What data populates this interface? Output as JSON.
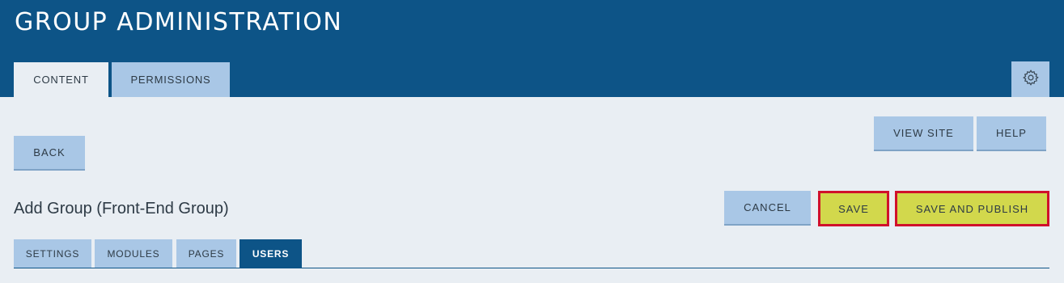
{
  "header": {
    "title": "GROUP ADMINISTRATION",
    "tabs": [
      {
        "label": "CONTENT",
        "active": true
      },
      {
        "label": "PERMISSIONS",
        "active": false
      }
    ],
    "settings_icon": "gear-icon"
  },
  "toolbar": {
    "back_label": "BACK",
    "view_site_label": "VIEW SITE",
    "help_label": "HELP"
  },
  "page": {
    "title": "Add Group (Front-End Group)",
    "cancel_label": "CANCEL",
    "save_label": "SAVE",
    "save_publish_label": "SAVE AND PUBLISH"
  },
  "subtabs": [
    {
      "label": "SETTINGS",
      "active": false
    },
    {
      "label": "MODULES",
      "active": false
    },
    {
      "label": "PAGES",
      "active": false
    },
    {
      "label": "USERS",
      "active": true
    }
  ],
  "colors": {
    "header_bg": "#0d5487",
    "button_bg": "#a9c7e6",
    "highlight_bg": "#d2d84c",
    "highlight_border": "#d0112b"
  }
}
